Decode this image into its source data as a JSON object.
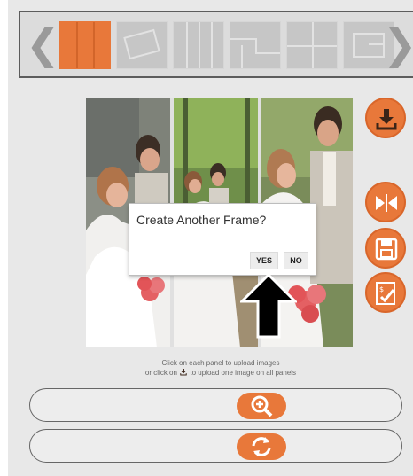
{
  "layouts": [
    {
      "name": "three-vertical",
      "active": true
    },
    {
      "name": "tilted-frame",
      "active": false
    },
    {
      "name": "four-vertical",
      "active": false
    },
    {
      "name": "stepped",
      "active": false
    },
    {
      "name": "quad-grid",
      "active": false
    },
    {
      "name": "nested-frame",
      "active": false
    }
  ],
  "nav": {
    "prev_glyph": "❮",
    "next_glyph": "❯"
  },
  "dialog": {
    "title": "Create Another Frame?",
    "yes_label": "YES",
    "no_label": "NO"
  },
  "instructions": {
    "line1": "Click on each panel to upload images",
    "line2_prefix": "or click on",
    "line2_suffix": "to upload one image on all panels"
  },
  "side_buttons": [
    "download-icon",
    "flip-icon",
    "save-icon",
    "checkout-icon"
  ],
  "actions": [
    "zoom-in-icon",
    "refresh-icon"
  ],
  "colors": {
    "accent": "#e8783a",
    "panel_bg": "#e8e8e8"
  }
}
